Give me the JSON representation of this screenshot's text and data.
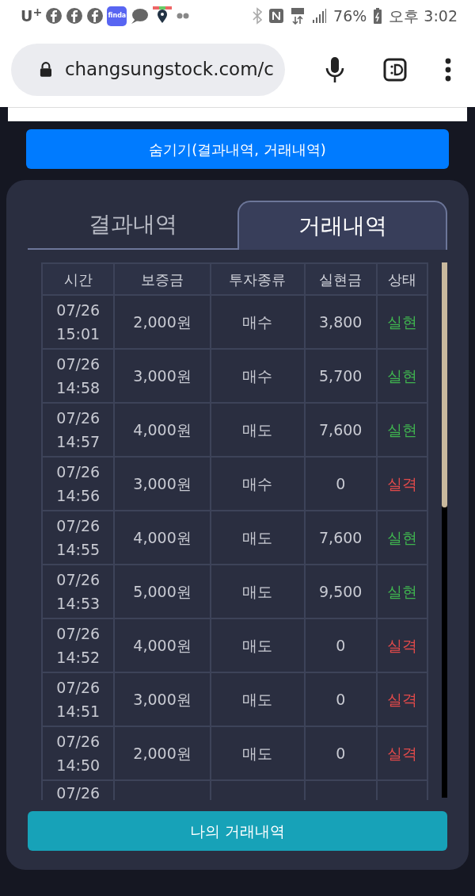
{
  "status_bar": {
    "carrier": "U",
    "carrier_mark": "+",
    "app_badge": "finda",
    "battery": "76%",
    "time": "오후 3:02"
  },
  "browser": {
    "url": "changsungstock.com/c"
  },
  "hide_button": "숨기기(결과내역, 거래내역)",
  "tabs": [
    {
      "label": "결과내역",
      "selected": false
    },
    {
      "label": "거래내역",
      "selected": true
    }
  ],
  "table": {
    "columns": [
      "시간",
      "보증금",
      "투자종류",
      "실현금",
      "상태"
    ],
    "rows": [
      {
        "date": "07/26",
        "time": "15:01",
        "deposit": "2,000원",
        "type": "매수",
        "realized": "3,800",
        "status": "실현",
        "kind": "success"
      },
      {
        "date": "07/26",
        "time": "14:58",
        "deposit": "3,000원",
        "type": "매수",
        "realized": "5,700",
        "status": "실현",
        "kind": "success"
      },
      {
        "date": "07/26",
        "time": "14:57",
        "deposit": "4,000원",
        "type": "매도",
        "realized": "7,600",
        "status": "실현",
        "kind": "success"
      },
      {
        "date": "07/26",
        "time": "14:56",
        "deposit": "3,000원",
        "type": "매수",
        "realized": "0",
        "status": "실격",
        "kind": "fail"
      },
      {
        "date": "07/26",
        "time": "14:55",
        "deposit": "4,000원",
        "type": "매도",
        "realized": "7,600",
        "status": "실현",
        "kind": "success"
      },
      {
        "date": "07/26",
        "time": "14:53",
        "deposit": "5,000원",
        "type": "매도",
        "realized": "9,500",
        "status": "실현",
        "kind": "success"
      },
      {
        "date": "07/26",
        "time": "14:52",
        "deposit": "4,000원",
        "type": "매도",
        "realized": "0",
        "status": "실격",
        "kind": "fail"
      },
      {
        "date": "07/26",
        "time": "14:51",
        "deposit": "3,000원",
        "type": "매도",
        "realized": "0",
        "status": "실격",
        "kind": "fail"
      },
      {
        "date": "07/26",
        "time": "14:50",
        "deposit": "2,000원",
        "type": "매도",
        "realized": "0",
        "status": "실격",
        "kind": "fail"
      },
      {
        "date": "07/26"
      }
    ]
  },
  "my_trades_button": "나의 거래내역"
}
